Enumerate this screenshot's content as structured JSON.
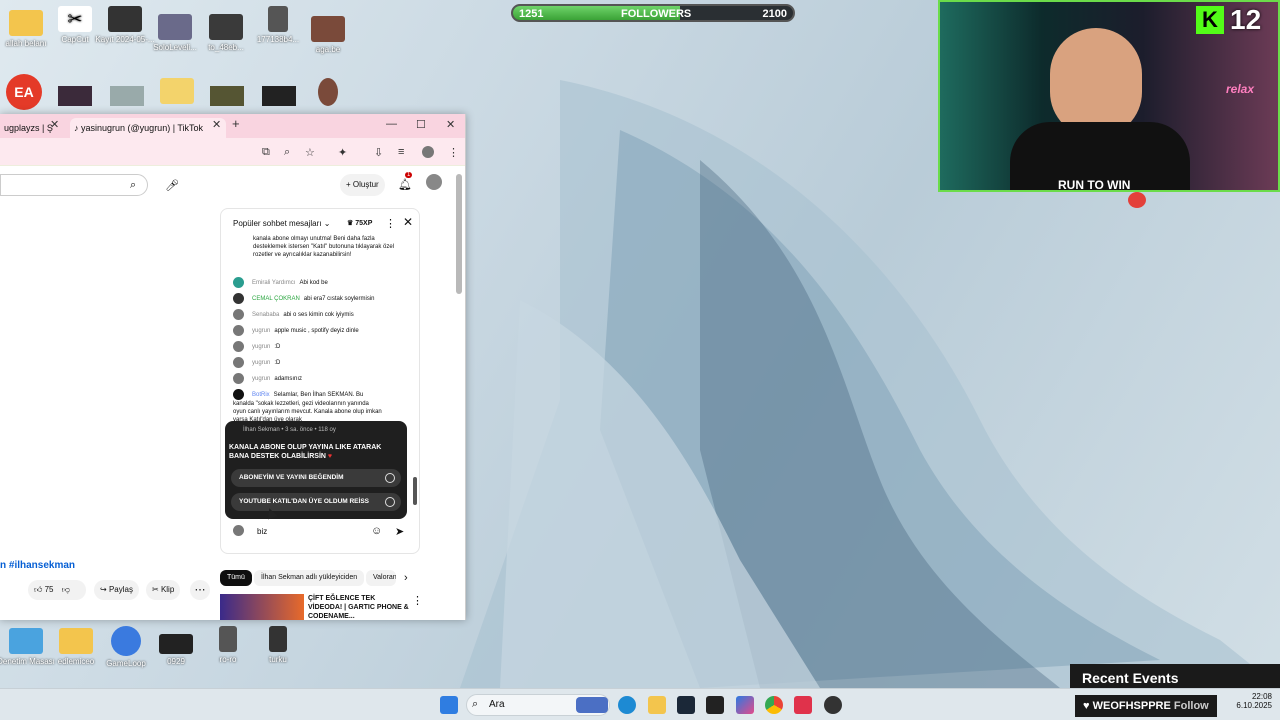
{
  "desktop_icons_top": [
    "allah belanı",
    "CapCut",
    "Kayıt 2024-05-...",
    "SoloLeveli...",
    "to_48eb...",
    "177138b4...",
    "aga.be"
  ],
  "desktop_icons_bottom": [
    "Denetim Masası",
    "edlemiceo",
    "GameLoop",
    "0929",
    "ro-ro",
    "turku"
  ],
  "followers": {
    "current": "1251",
    "label": "FOLLOWERS",
    "goal": "2100",
    "progress": 0.5955
  },
  "webcam": {
    "shirt_text": "RUN TO WIN",
    "neon": "relax"
  },
  "kick": {
    "logo": "K",
    "count": "12"
  },
  "browser": {
    "tab1": "ugplayzs | Ş",
    "tab2": "yasinugrun (@yugrun) | TikTok",
    "yt_create": "Oluştur",
    "notif_count": "1"
  },
  "chat": {
    "header": "Popüler sohbet mesajları",
    "xp": "75XP",
    "intro": "kanala abone olmayı unutma! Beni daha fazla desteklemek istersen \"Katıl\" butonuna tıklayarak özel rozetler ve ayrıcalıklar kazanabilirsin!",
    "messages": [
      {
        "author": "Emirali Yardımcı",
        "text": "Abi kod be"
      },
      {
        "author": "CEMAL ÇOKRAN",
        "text": "abi era7 cıstak soylermisin"
      },
      {
        "author": "Senababa",
        "text": "abi o ses kimin cok iyiymis"
      },
      {
        "author": "yugrun",
        "text": "apple music , spotify deyiz dinle"
      },
      {
        "author": "yugrun",
        "text": ":D"
      },
      {
        "author": "yugrun",
        "text": ":D"
      },
      {
        "author": "yugrun",
        "text": "adamsınız"
      },
      {
        "author": "BotRix",
        "text": "Selamlar, Ben İlhan SEKMAN. Bu kanalda \"sokak lezzetleri, gezi videolarının yanında oyun canlı yayınlarım mevcut. Kanala abone olup imkan varsa Katıl'dan üye olarak"
      }
    ],
    "poll": {
      "meta": "İlhan Sekman • 3 sa. önce • 118 oy",
      "question": "KANALA ABONE OLUP YAYINA LIKE ATARAK BANA DESTEK OLABİLİRSİN",
      "options": [
        "ABONEYİM VE YAYINI BEĞENDİM",
        "YOUTUBE KATIL'DAN ÜYE OLDUM REİSS"
      ]
    },
    "input_value": "biz"
  },
  "video": {
    "hashtag": "n #ilhansekman",
    "likes": "75",
    "share": "Paylaş",
    "clip": "Klip"
  },
  "chips": [
    "Tümü",
    "İlhan Sekman adlı yükleyiciden",
    "Valorant"
  ],
  "rec_title": "ÇİFT EĞLENCE TEK VİDEODA! | GARTIC PHONE & CODENAME...",
  "taskbar": {
    "search": "Ara",
    "time": "22:08",
    "date": "6.10.2025"
  },
  "recent_events": "Recent Events",
  "follow_alert": {
    "name": "WEOFHSPPRE",
    "action": "Follow"
  }
}
